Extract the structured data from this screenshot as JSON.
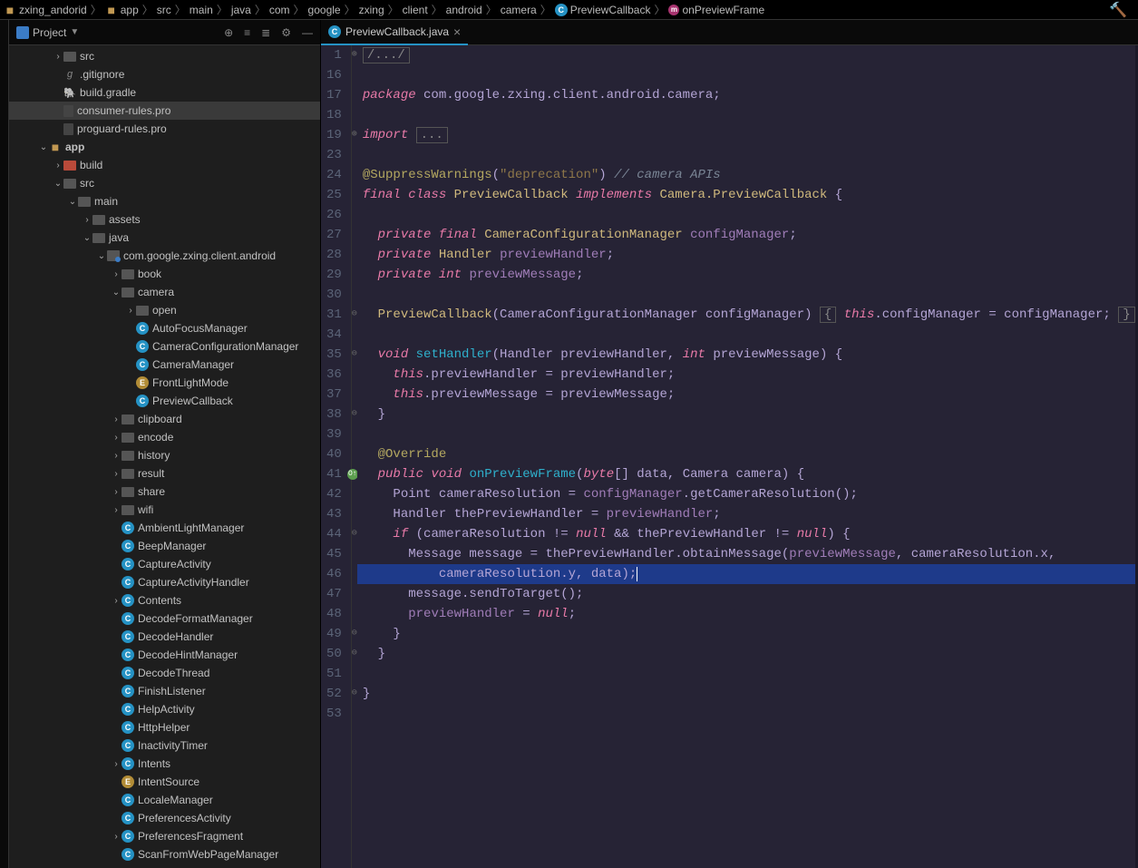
{
  "breadcrumb": [
    {
      "label": "zxing_andorid",
      "icon": "module"
    },
    {
      "label": "app",
      "icon": "module"
    },
    {
      "label": "src",
      "icon": null
    },
    {
      "label": "main",
      "icon": null
    },
    {
      "label": "java",
      "icon": null
    },
    {
      "label": "com",
      "icon": null
    },
    {
      "label": "google",
      "icon": null
    },
    {
      "label": "zxing",
      "icon": null
    },
    {
      "label": "client",
      "icon": null
    },
    {
      "label": "android",
      "icon": null
    },
    {
      "label": "camera",
      "icon": null
    },
    {
      "label": "PreviewCallback",
      "icon": "class"
    },
    {
      "label": "onPreviewFrame",
      "icon": "method"
    }
  ],
  "sidebar": {
    "title": "Project",
    "items": [
      {
        "depth": 2,
        "chev": ">",
        "icon": "folder",
        "label": "src"
      },
      {
        "depth": 2,
        "chev": "",
        "icon": "git",
        "label": ".gitignore"
      },
      {
        "depth": 2,
        "chev": "",
        "icon": "gradle",
        "label": "build.gradle"
      },
      {
        "depth": 2,
        "chev": "",
        "icon": "file",
        "label": "consumer-rules.pro",
        "selected": true
      },
      {
        "depth": 2,
        "chev": "",
        "icon": "file",
        "label": "proguard-rules.pro"
      },
      {
        "depth": 1,
        "chev": "v",
        "icon": "module",
        "label": "app",
        "bold": true
      },
      {
        "depth": 2,
        "chev": ">",
        "icon": "folder-red",
        "label": "build"
      },
      {
        "depth": 2,
        "chev": "v",
        "icon": "folder",
        "label": "src"
      },
      {
        "depth": 3,
        "chev": "v",
        "icon": "folder",
        "label": "main"
      },
      {
        "depth": 4,
        "chev": ">",
        "icon": "folder",
        "label": "assets"
      },
      {
        "depth": 4,
        "chev": "v",
        "icon": "folder",
        "label": "java"
      },
      {
        "depth": 5,
        "chev": "v",
        "icon": "package",
        "label": "com.google.zxing.client.android"
      },
      {
        "depth": 6,
        "chev": ">",
        "icon": "folder",
        "label": "book"
      },
      {
        "depth": 6,
        "chev": "v",
        "icon": "folder",
        "label": "camera"
      },
      {
        "depth": 7,
        "chev": ">",
        "icon": "folder",
        "label": "open"
      },
      {
        "depth": 7,
        "chev": "",
        "icon": "class",
        "label": "AutoFocusManager"
      },
      {
        "depth": 7,
        "chev": "",
        "icon": "class",
        "label": "CameraConfigurationManager"
      },
      {
        "depth": 7,
        "chev": "",
        "icon": "class",
        "label": "CameraManager"
      },
      {
        "depth": 7,
        "chev": "",
        "icon": "enum",
        "label": "FrontLightMode"
      },
      {
        "depth": 7,
        "chev": "",
        "icon": "class",
        "label": "PreviewCallback"
      },
      {
        "depth": 6,
        "chev": ">",
        "icon": "folder",
        "label": "clipboard"
      },
      {
        "depth": 6,
        "chev": ">",
        "icon": "folder",
        "label": "encode"
      },
      {
        "depth": 6,
        "chev": ">",
        "icon": "folder",
        "label": "history"
      },
      {
        "depth": 6,
        "chev": ">",
        "icon": "folder",
        "label": "result"
      },
      {
        "depth": 6,
        "chev": ">",
        "icon": "folder",
        "label": "share"
      },
      {
        "depth": 6,
        "chev": ">",
        "icon": "folder",
        "label": "wifi"
      },
      {
        "depth": 6,
        "chev": "",
        "icon": "class",
        "label": "AmbientLightManager"
      },
      {
        "depth": 6,
        "chev": "",
        "icon": "class",
        "label": "BeepManager"
      },
      {
        "depth": 6,
        "chev": "",
        "icon": "class",
        "label": "CaptureActivity"
      },
      {
        "depth": 6,
        "chev": "",
        "icon": "class",
        "label": "CaptureActivityHandler"
      },
      {
        "depth": 6,
        "chev": ">",
        "icon": "class",
        "label": "Contents"
      },
      {
        "depth": 6,
        "chev": "",
        "icon": "class",
        "label": "DecodeFormatManager"
      },
      {
        "depth": 6,
        "chev": "",
        "icon": "class",
        "label": "DecodeHandler"
      },
      {
        "depth": 6,
        "chev": "",
        "icon": "class",
        "label": "DecodeHintManager"
      },
      {
        "depth": 6,
        "chev": "",
        "icon": "class",
        "label": "DecodeThread"
      },
      {
        "depth": 6,
        "chev": "",
        "icon": "class",
        "label": "FinishListener"
      },
      {
        "depth": 6,
        "chev": "",
        "icon": "class",
        "label": "HelpActivity"
      },
      {
        "depth": 6,
        "chev": "",
        "icon": "class",
        "label": "HttpHelper"
      },
      {
        "depth": 6,
        "chev": "",
        "icon": "class",
        "label": "InactivityTimer"
      },
      {
        "depth": 6,
        "chev": ">",
        "icon": "class",
        "label": "Intents"
      },
      {
        "depth": 6,
        "chev": "",
        "icon": "enum",
        "label": "IntentSource"
      },
      {
        "depth": 6,
        "chev": "",
        "icon": "class",
        "label": "LocaleManager"
      },
      {
        "depth": 6,
        "chev": "",
        "icon": "class",
        "label": "PreferencesActivity"
      },
      {
        "depth": 6,
        "chev": ">",
        "icon": "class",
        "label": "PreferencesFragment"
      },
      {
        "depth": 6,
        "chev": "",
        "icon": "class",
        "label": "ScanFromWebPageManager"
      }
    ]
  },
  "tab": {
    "name": "PreviewCallback.java"
  },
  "lineNumbers": [
    "1",
    "16",
    "17",
    "18",
    "19",
    "23",
    "24",
    "25",
    "26",
    "27",
    "28",
    "29",
    "30",
    "31",
    "34",
    "35",
    "36",
    "37",
    "38",
    "39",
    "40",
    "41",
    "42",
    "43",
    "44",
    "45",
    "46",
    "47",
    "48",
    "49",
    "50",
    "51",
    "52",
    "53"
  ],
  "foldMarks": [
    "⊕",
    "",
    "",
    "",
    "⊕",
    "",
    "",
    "",
    "",
    "",
    "",
    "",
    "",
    "⊖",
    "",
    "⊖",
    "",
    "",
    "⊖",
    "",
    "",
    "⊖",
    "",
    "",
    "⊖",
    "",
    "",
    "",
    "",
    "⊖",
    "⊖",
    "",
    "⊖",
    ""
  ],
  "gutterMarkers": [
    {
      "line": 41,
      "type": "override"
    }
  ],
  "code": {
    "l1": {
      "pre": "",
      "fold": "/.../"
    },
    "l16": "",
    "l17": {
      "kw": "package",
      "rest": " com.google.zxing.client.android.camera;"
    },
    "l18": "",
    "l19": {
      "kw": "import ",
      "fold": "..."
    },
    "l23": "",
    "l24": {
      "ann": "@SuppressWarnings",
      "p": "(",
      "str": "\"deprecation\"",
      "p2": ") ",
      "cm": "// camera APIs"
    },
    "l25": {
      "kw": "final class ",
      "type": "PreviewCallback ",
      "kw2": "implements ",
      "type2": "Camera.PreviewCallback",
      "p": " {"
    },
    "l26": "",
    "l27": {
      "ind": "  ",
      "kw": "private final ",
      "type": "CameraConfigurationManager ",
      "fld": "configManager",
      "p": ";"
    },
    "l28": {
      "ind": "  ",
      "kw": "private ",
      "type": "Handler ",
      "fld": "previewHandler",
      "p": ";"
    },
    "l29": {
      "ind": "  ",
      "kw": "private int ",
      "fld": "previewMessage",
      "p": ";"
    },
    "l30": "",
    "l31": {
      "ind": "  ",
      "type": "PreviewCallback",
      "p": "(CameraConfigurationManager configManager) ",
      "b1": "{ ",
      "kw": "this",
      "p2": ".configManager = configManager; ",
      "b2": "}"
    },
    "l34": "",
    "l35": {
      "ind": "  ",
      "kw": "void ",
      "fn": "setHandler",
      "p": "(Handler previewHandler, ",
      "kw2": "int",
      "p2": " previewMessage) {"
    },
    "l36": {
      "ind": "    ",
      "kw": "this",
      "p": ".previewHandler = previewHandler;"
    },
    "l37": {
      "ind": "    ",
      "kw": "this",
      "p": ".previewMessage = previewMessage;"
    },
    "l38": {
      "ind": "  ",
      "p": "}"
    },
    "l39": "",
    "l40": {
      "ind": "  ",
      "ann": "@Override"
    },
    "l41": {
      "ind": "  ",
      "kw": "public void ",
      "fn": "onPreviewFrame",
      "p": "(",
      "kw2": "byte",
      "p2": "[] data, Camera camera) {"
    },
    "l42": {
      "ind": "    ",
      "p": "Point cameraResolution = ",
      "fld": "configManager",
      "p2": ".getCameraResolution();"
    },
    "l43": {
      "ind": "    ",
      "p": "Handler thePreviewHandler = ",
      "fld": "previewHandler",
      "p2": ";"
    },
    "l44": {
      "ind": "    ",
      "kw": "if ",
      "p": "(cameraResolution != ",
      "kw2": "null",
      "p2": " && thePreviewHandler != ",
      "kw3": "null",
      "p3": ") {"
    },
    "l45": {
      "ind": "      ",
      "p": "Message message = thePreviewHandler.obtainMessage(",
      "fld": "previewMessage",
      "p2": ", cameraResolution.x,"
    },
    "l46": {
      "ind": "          ",
      "p": "cameraResolution.y, data);"
    },
    "l47": {
      "ind": "      ",
      "p": "message.sendToTarget();"
    },
    "l48": {
      "ind": "      ",
      "fld": "previewHandler",
      "p": " = ",
      "kw": "null",
      "p2": ";"
    },
    "l49": {
      "ind": "    ",
      "p": "}"
    },
    "l50": {
      "ind": "  ",
      "p": "}"
    },
    "l51": "",
    "l52": {
      "p": "}"
    },
    "l53": ""
  }
}
